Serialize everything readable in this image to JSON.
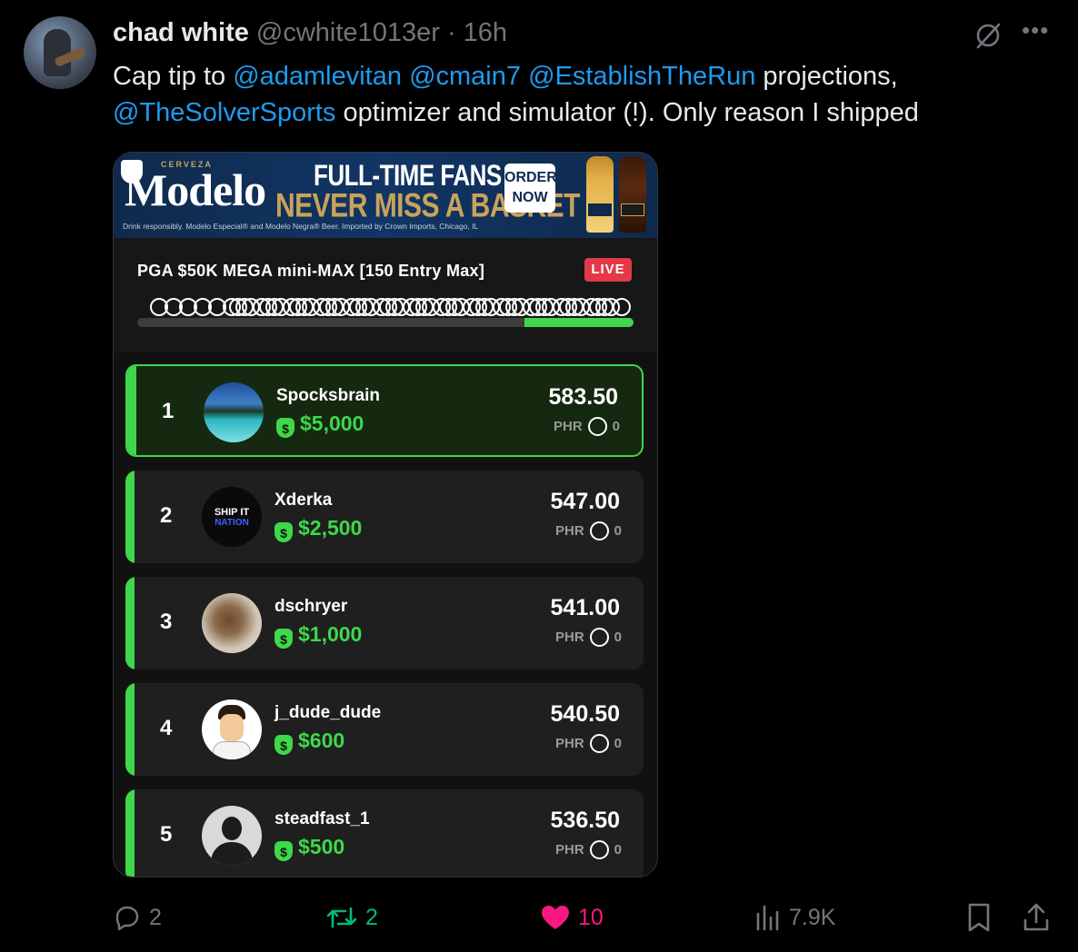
{
  "tweet": {
    "author_name": "chad white",
    "handle": "@cwhite1013er",
    "separator": "·",
    "time": "16h",
    "text_parts": {
      "lead": "Cap tip to ",
      "mention1": "@adamlevitan",
      "mention2": "@cmain7",
      "mention3": "@EstablishTheRun",
      "mid": "  projections, ",
      "mention4": "@TheSolverSports",
      "tail": " optimizer and simulator (!). Only reason I shipped"
    }
  },
  "ad": {
    "brand_small": "CERVEZA",
    "brand": "Modelo",
    "headline1": "FULL-TIME FANS",
    "headline2": "NEVER MISS A BASKET",
    "cta_line1": "ORDER",
    "cta_line2": "NOW",
    "disclaimer": "Drink responsibly. Modelo Especial® and Modelo Negra® Beer. Imported by Crown Imports, Chicago, IL"
  },
  "contest": {
    "title": "PGA $50K MEGA mini-MAX [150 Entry Max]",
    "status": "LIVE",
    "progress_fraction": 0.22
  },
  "leaderboard": [
    {
      "rank": "1",
      "username": "Spocksbrain",
      "prize": "$5,000",
      "score": "583.50",
      "phr_label": "PHR",
      "phr_value": "0"
    },
    {
      "rank": "2",
      "username": "Xderka",
      "prize": "$2,500",
      "score": "547.00",
      "phr_label": "PHR",
      "phr_value": "0",
      "avatar_text1": "SHIP IT",
      "avatar_text2": "NATION"
    },
    {
      "rank": "3",
      "username": "dschryer",
      "prize": "$1,000",
      "score": "541.00",
      "phr_label": "PHR",
      "phr_value": "0"
    },
    {
      "rank": "4",
      "username": "j_dude_dude",
      "prize": "$600",
      "score": "540.50",
      "phr_label": "PHR",
      "phr_value": "0"
    },
    {
      "rank": "5",
      "username": "steadfast_1",
      "prize": "$500",
      "score": "536.50",
      "phr_label": "PHR",
      "phr_value": "0"
    }
  ],
  "actions": {
    "replies": "2",
    "reposts": "2",
    "likes": "10",
    "views": "7.9K"
  },
  "colors": {
    "accent_link": "#1d9bf0",
    "green": "#3ed84a",
    "live_red": "#e33847",
    "like_pink": "#f91880",
    "repost_green": "#00ba7c"
  }
}
